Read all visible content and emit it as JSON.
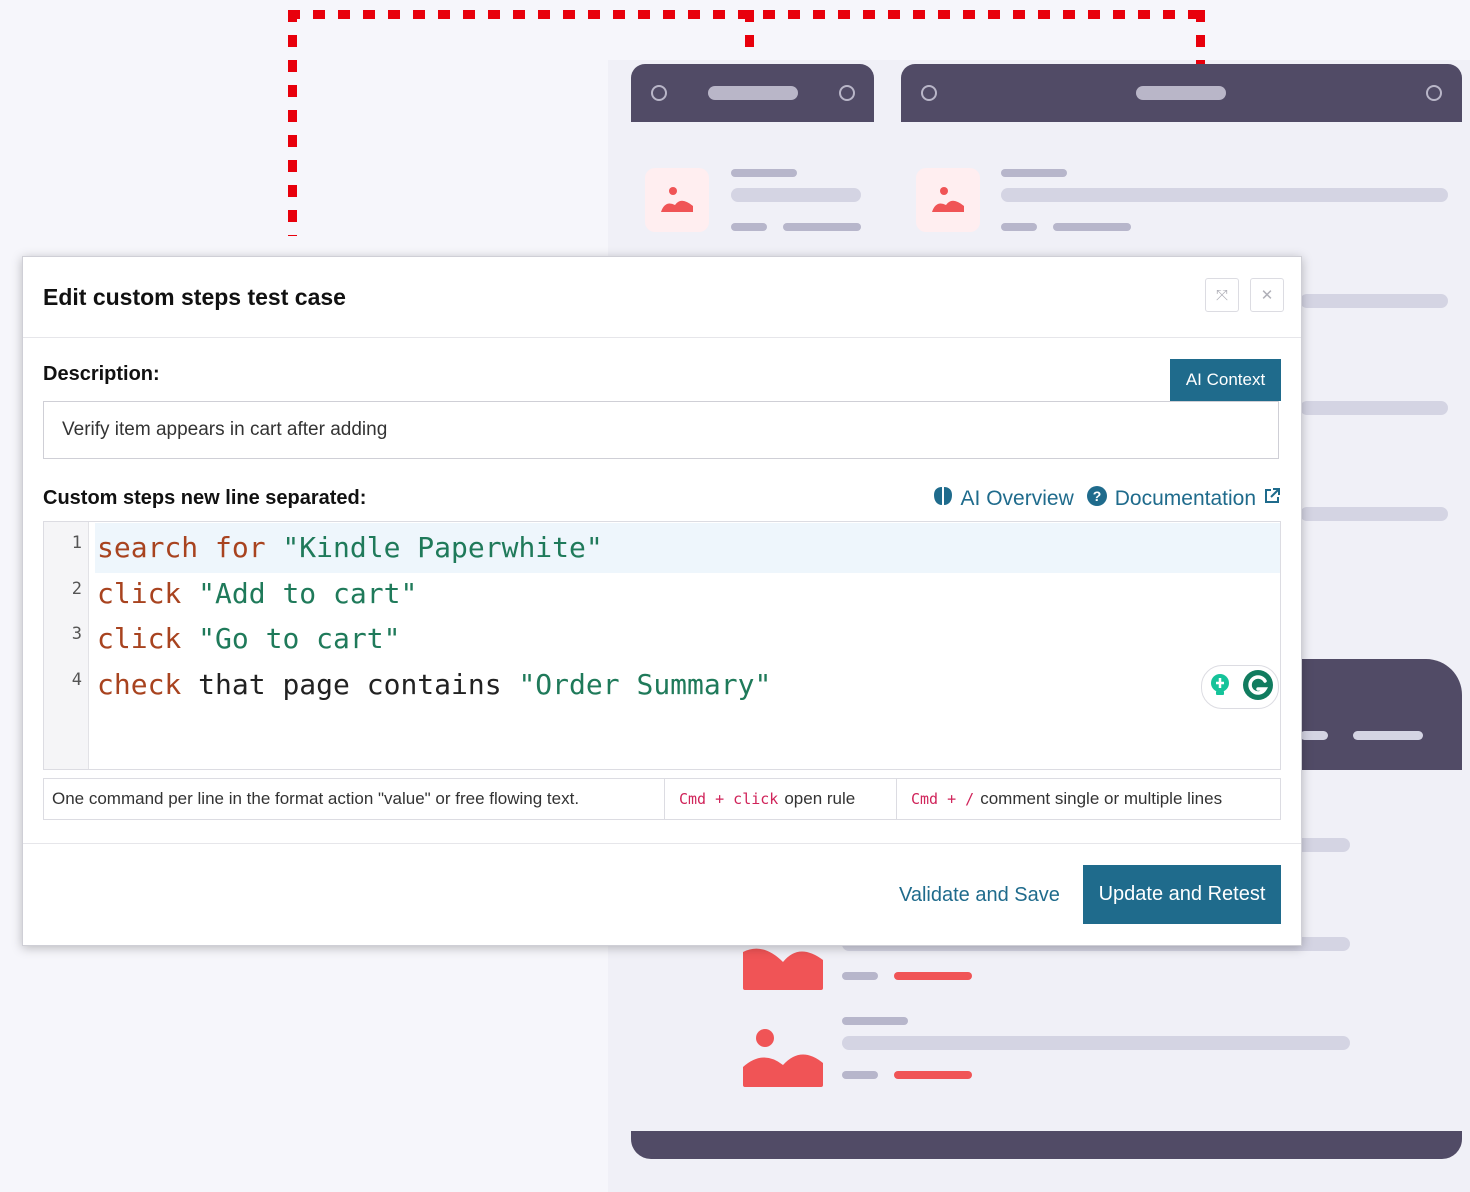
{
  "modal": {
    "title": "Edit custom steps test case",
    "description_label": "Description:",
    "ai_context_label": "AI Context",
    "description_value": "Verify item appears in cart after adding",
    "steps_label": "Custom steps new line separated:",
    "ai_overview_label": "AI Overview",
    "documentation_label": "Documentation",
    "line_numbers": [
      "1",
      "2",
      "3",
      "4"
    ],
    "steps": [
      {
        "t1": "search for",
        "t2": " \"Kindle Paperwhite\""
      },
      {
        "t1": "click",
        "t2": " \"Add to cart\""
      },
      {
        "t1": "click",
        "t2": " \"Go to cart\""
      },
      {
        "t1": "check",
        "t2": " that page contains ",
        "t3": "\"Order Summary\""
      }
    ],
    "hints": {
      "format": "One command per line in the format action \"value\" or free flowing text.",
      "cmd_click_key": "Cmd + click",
      "cmd_click_text": "open rule",
      "cmd_slash_key": "Cmd + /",
      "cmd_slash_text": "comment single or multiple lines"
    },
    "validate_label": "Validate and Save",
    "update_label": "Update and Retest"
  },
  "colors": {
    "accent": "#1f6b8c",
    "keyword": "#a8431f",
    "string": "#1f7a5a",
    "illustration_red": "#f05456",
    "illustration_dark": "#514b66"
  },
  "icons": [
    "expand-icon",
    "close-icon",
    "brain-icon",
    "help-circle-icon",
    "external-link-icon",
    "lightbulb-icon",
    "grammarly-icon",
    "image-placeholder-icon"
  ]
}
